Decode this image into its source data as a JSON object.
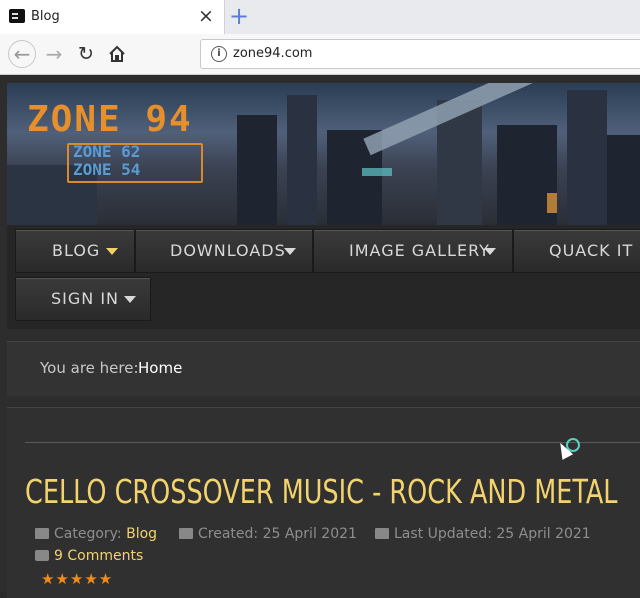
{
  "browser": {
    "tab_title": "Blog",
    "close_glyph": "×",
    "new_tab_glyph": "+",
    "url": "zone94.com",
    "info_glyph": "i",
    "back_glyph": "←",
    "forward_glyph": "→",
    "reload_glyph": "↻",
    "home_glyph": "⌂"
  },
  "banner": {
    "logo_main": "ZONE 94",
    "logo_sub_1": "ZONE 62",
    "logo_sub_2": "ZONE 54"
  },
  "nav": {
    "items": [
      {
        "label": "BLOG"
      },
      {
        "label": "DOWNLOADS"
      },
      {
        "label": "IMAGE GALLERY"
      },
      {
        "label": "QUACK IT"
      },
      {
        "label": "SIGN IN"
      }
    ]
  },
  "breadcrumb": {
    "label": "You are here:",
    "home": "Home"
  },
  "article": {
    "title": "CELLO CROSSOVER MUSIC - ROCK AND METAL",
    "category_label": "Category:",
    "category_value": "Blog",
    "created": "Created: 25 April 2021",
    "updated": "Last Updated: 25 April 2021",
    "comments": "9 Comments",
    "rating": 5,
    "stars_glyph": "★★★★★"
  },
  "colors": {
    "accent": "#f2d36e",
    "stars": "#f08a1c"
  }
}
